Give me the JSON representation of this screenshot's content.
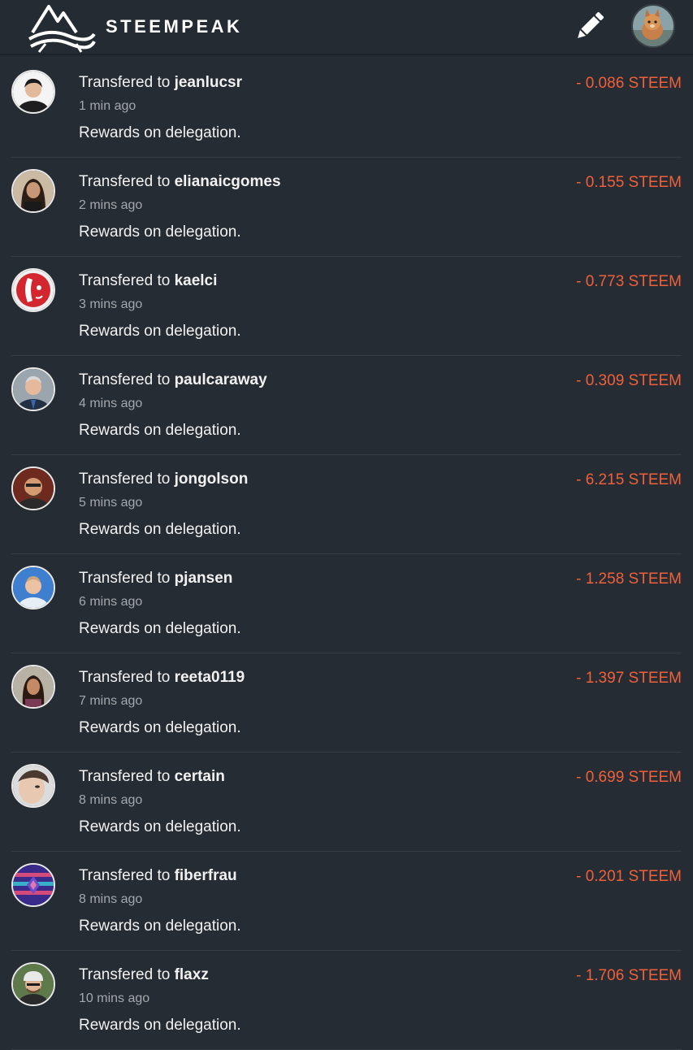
{
  "header": {
    "brand": "STEEMPEAK",
    "edit_icon": "pencil-icon",
    "logo_icon": "steempeak-mountain-logo"
  },
  "colors": {
    "background": "#262c33",
    "amount": "#f0603a",
    "divider": "#353c44"
  },
  "transfers": [
    {
      "prefix": "Transfered to ",
      "user": "jeanlucsr",
      "time": "1 min ago",
      "memo": "Rewards on delegation.",
      "amount": "- 0.086 STEEM"
    },
    {
      "prefix": "Transfered to ",
      "user": "elianaicgomes",
      "time": "2 mins ago",
      "memo": "Rewards on delegation.",
      "amount": "- 0.155 STEEM"
    },
    {
      "prefix": "Transfered to ",
      "user": "kaelci",
      "time": "3 mins ago",
      "memo": "Rewards on delegation.",
      "amount": "- 0.773 STEEM"
    },
    {
      "prefix": "Transfered to ",
      "user": "paulcaraway",
      "time": "4 mins ago",
      "memo": "Rewards on delegation.",
      "amount": "- 0.309 STEEM"
    },
    {
      "prefix": "Transfered to ",
      "user": "jongolson",
      "time": "5 mins ago",
      "memo": "Rewards on delegation.",
      "amount": "- 6.215 STEEM"
    },
    {
      "prefix": "Transfered to ",
      "user": "pjansen",
      "time": "6 mins ago",
      "memo": "Rewards on delegation.",
      "amount": "- 1.258 STEEM"
    },
    {
      "prefix": "Transfered to ",
      "user": "reeta0119",
      "time": "7 mins ago",
      "memo": "Rewards on delegation.",
      "amount": "- 1.397 STEEM"
    },
    {
      "prefix": "Transfered to ",
      "user": "certain",
      "time": "8 mins ago",
      "memo": "Rewards on delegation.",
      "amount": "- 0.699 STEEM"
    },
    {
      "prefix": "Transfered to ",
      "user": "fiberfrau",
      "time": "8 mins ago",
      "memo": "Rewards on delegation.",
      "amount": "- 0.201 STEEM"
    },
    {
      "prefix": "Transfered to ",
      "user": "flaxz",
      "time": "10 mins ago",
      "memo": "Rewards on delegation.",
      "amount": "- 1.706 STEEM"
    }
  ]
}
